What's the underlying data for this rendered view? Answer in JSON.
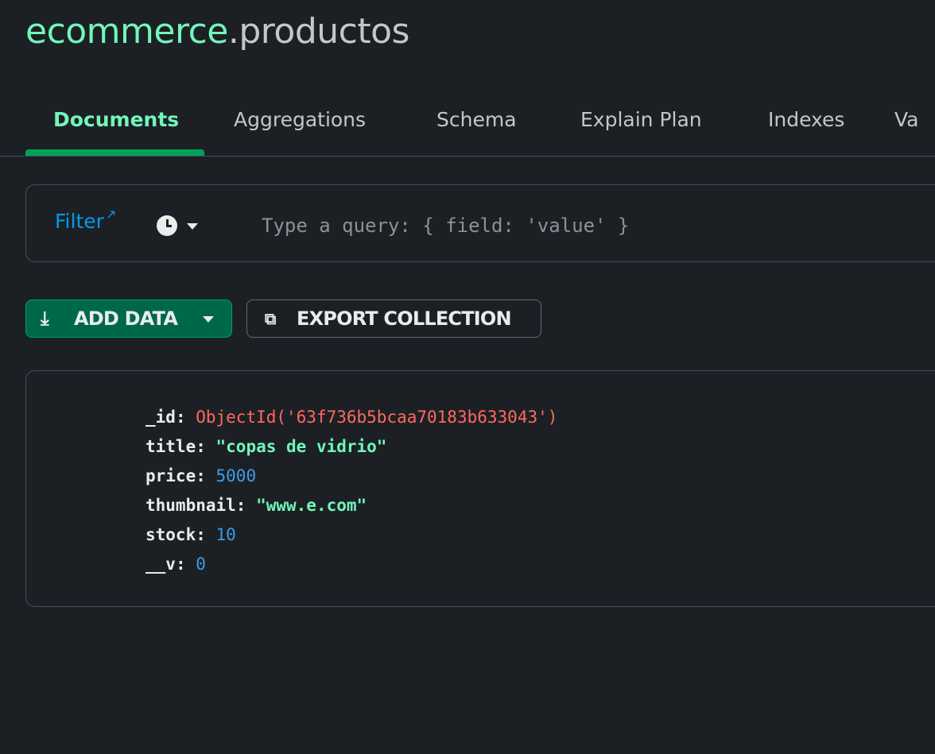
{
  "header": {
    "database": "ecommerce",
    "separator": ".",
    "collection": "productos"
  },
  "tabs": [
    {
      "label": "Documents",
      "active": true
    },
    {
      "label": "Aggregations"
    },
    {
      "label": "Schema"
    },
    {
      "label": "Explain Plan"
    },
    {
      "label": "Indexes"
    },
    {
      "label": "Va"
    }
  ],
  "filter": {
    "label": "Filter",
    "external_icon": "external-link-icon",
    "history_icon": "clock-icon",
    "placeholder": "Type a query: { field: 'value' }"
  },
  "toolbar": {
    "add_data_label": "ADD DATA",
    "add_data_icon": "download-icon",
    "export_label": "EXPORT COLLECTION",
    "export_icon": "export-icon"
  },
  "document": {
    "fields": [
      {
        "key": "_id",
        "value": "ObjectId('63f736b5bcaa70183b633043')",
        "type": "objectid"
      },
      {
        "key": "title",
        "value": "\"copas de vidrio\"",
        "type": "string"
      },
      {
        "key": "price",
        "value": "5000",
        "type": "number"
      },
      {
        "key": "thumbnail",
        "value": "\"www.e.com\"",
        "type": "string"
      },
      {
        "key": "stock",
        "value": "10",
        "type": "number"
      },
      {
        "key": "__v",
        "value": "0",
        "type": "number"
      }
    ]
  },
  "colors": {
    "background": "#1c2024",
    "accent": "#71f6ba",
    "link": "#0498ec",
    "objectid": "#ff6960",
    "number": "#3e9be8",
    "button_green": "#00684a"
  }
}
